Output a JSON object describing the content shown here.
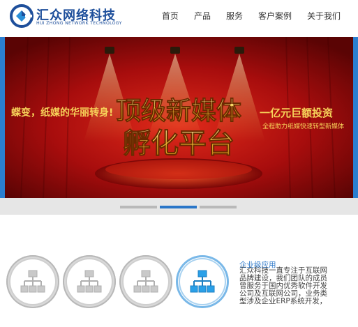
{
  "logo": {
    "title": "汇众网络科技",
    "subtitle": "HUI ZHONG NETWORK TECHNOLOGY"
  },
  "nav": {
    "items": [
      "首页",
      "产品",
      "服务",
      "客户案例",
      "关于我们"
    ]
  },
  "banner": {
    "left_slogan": "蝶变，纸媒的华丽转身!",
    "headline_1": "顶级新媒体",
    "headline_2": "孵化平台",
    "right_title": "一亿元巨额投资",
    "right_sub": "全程助力纸媒快速转型新媒体"
  },
  "slider": {
    "count": 3,
    "active_index": 1
  },
  "feature": {
    "title": "企业级应用",
    "lines": [
      "汇众科技一直专注于互联网",
      "品牌建设，我们团队的成员",
      "曾服务于国内优秀软件开发",
      "公司及互联网公司，业务类",
      "型涉及企业ERP系统开发，"
    ],
    "icons": [
      "network-icon",
      "network-icon",
      "network-icon",
      "network-icon"
    ],
    "active_icon": 3
  },
  "colors": {
    "brand_blue": "#1e4f9b",
    "accent_blue": "#2a76c8",
    "banner_red": "#b01010",
    "gold": "#f5c43a"
  }
}
